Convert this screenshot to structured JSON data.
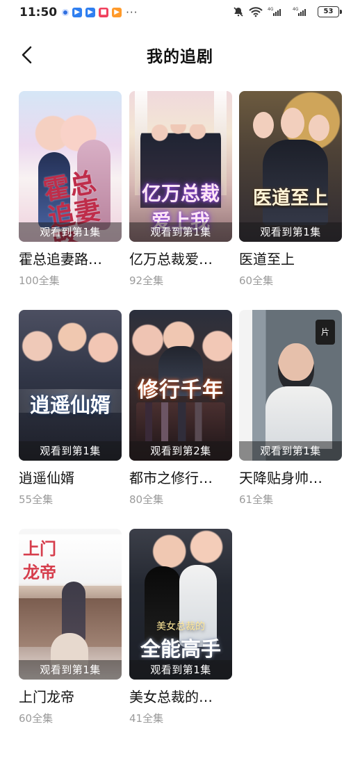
{
  "status": {
    "time": "11:50",
    "battery": "53",
    "more": "···",
    "icons": [
      "gear-dot",
      "app-blue-1",
      "app-blue-2",
      "app-red",
      "app-orange",
      "bell-off-icon",
      "wifi-icon",
      "signal-icon",
      "battery-icon"
    ]
  },
  "header": {
    "title": "我的追剧"
  },
  "dramas": [
    {
      "title": "霍总追妻路…",
      "episodes": "100全集",
      "progress": "观看到第1集",
      "poster_text": "霍总追妻路"
    },
    {
      "title": "亿万总裁爱…",
      "episodes": "92全集",
      "progress": "观看到第1集",
      "poster_text": "亿万总裁爱上我"
    },
    {
      "title": "医道至上",
      "episodes": "60全集",
      "progress": "观看到第1集",
      "poster_text": "医道至上"
    },
    {
      "title": "逍遥仙婿",
      "episodes": "55全集",
      "progress": "观看到第1集",
      "poster_text": "逍遥仙婿"
    },
    {
      "title": "都市之修行…",
      "episodes": "80全集",
      "progress": "观看到第2集",
      "poster_text": "修行千年"
    },
    {
      "title": "天降贴身帅…",
      "episodes": "61全集",
      "progress": "观看到第1集",
      "poster_text": ""
    },
    {
      "title": "上门龙帝",
      "episodes": "60全集",
      "progress": "观看到第1集",
      "poster_text": "上门龙帝"
    },
    {
      "title": "美女总裁的…",
      "episodes": "41全集",
      "progress": "观看到第1集",
      "poster_small_text": "美女总裁的",
      "poster_text": "全能高手"
    }
  ]
}
